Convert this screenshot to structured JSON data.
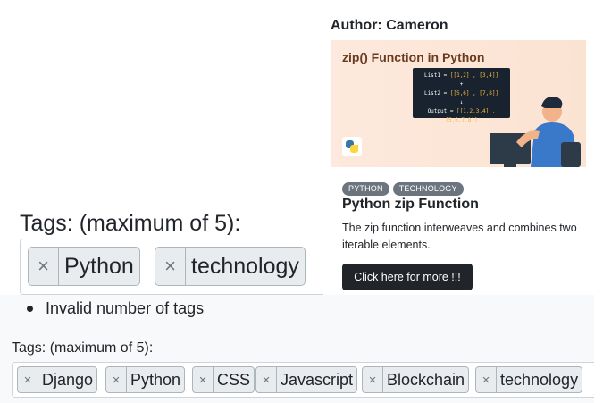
{
  "card": {
    "author": "Author: Cameron",
    "thumbnail": {
      "title": "zip() Function in Python",
      "code_lines": [
        {
          "label": "List1 = ",
          "value": "[[1,2] , [3,4]]"
        },
        {
          "label": "+",
          "value": ""
        },
        {
          "label": "List2 = ",
          "value": "[[5,6] , [7,8]]"
        },
        {
          "label": "↓",
          "value": ""
        },
        {
          "label": "Output = ",
          "value": "[[1,2,3,4] , [5,6,7,8]]"
        }
      ],
      "logo_icon": "python-logo-icon"
    },
    "badges": [
      "PYTHON",
      "TECHNOLOGY"
    ],
    "title": "Python zip Function",
    "text": "The zip function interweaves and combines two iterable elements.",
    "button_label": "Click here for more !!!"
  },
  "tags_large": {
    "label": "Tags: (maximum of 5):",
    "tags": [
      "Python",
      "technology"
    ],
    "remove_icon": "×"
  },
  "errors": [
    "Invalid number of tags"
  ],
  "tags_small": {
    "label": "Tags: (maximum of 5):",
    "tags": [
      "Django",
      "Python",
      "CSS",
      "Javascript",
      "Blockchain",
      "technology"
    ],
    "remove_icon": "×"
  },
  "colors": {
    "badge": "#6c757d",
    "button": "#212529",
    "tag_bg": "#e9ecef",
    "thumb_bg": "#fde9dd",
    "code_bg": "#18232f",
    "code_highlight": "#f6b93b"
  }
}
